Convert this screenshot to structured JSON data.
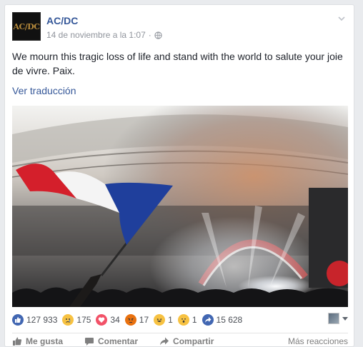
{
  "post": {
    "page_name": "AC/DC",
    "avatar_text": "AC/DC",
    "timestamp": "14 de noviembre a la 1:07",
    "audience_icon": "globe-icon",
    "text": "We mourn this tragic loss of life and stand with the world to salute your joie de vivre. Paix.",
    "translate_label": "Ver traducción"
  },
  "reactions": [
    {
      "type": "like",
      "icon": "like-icon",
      "color": "#4267b2",
      "count": "127 933"
    },
    {
      "type": "sad",
      "icon": "sad-icon",
      "color": "#f7c242",
      "count": "175"
    },
    {
      "type": "love",
      "icon": "love-icon",
      "color": "#f25268",
      "count": "34"
    },
    {
      "type": "angry",
      "icon": "angry-icon",
      "color": "#e9710f",
      "count": "17"
    },
    {
      "type": "haha",
      "icon": "haha-icon",
      "color": "#f7c242",
      "count": "1"
    },
    {
      "type": "wow",
      "icon": "wow-icon",
      "color": "#f7c242",
      "count": "1"
    },
    {
      "type": "share",
      "icon": "share-icon",
      "color": "#4267b2",
      "count": "15 628"
    }
  ],
  "actions": {
    "like": "Me gusta",
    "comment": "Comentar",
    "share": "Compartir",
    "more": "Más reacciones"
  },
  "colors": {
    "link": "#365899",
    "flag_blue": "#1f3f9c",
    "flag_red": "#d41f2b",
    "stage_lights": "#fff5e6"
  }
}
